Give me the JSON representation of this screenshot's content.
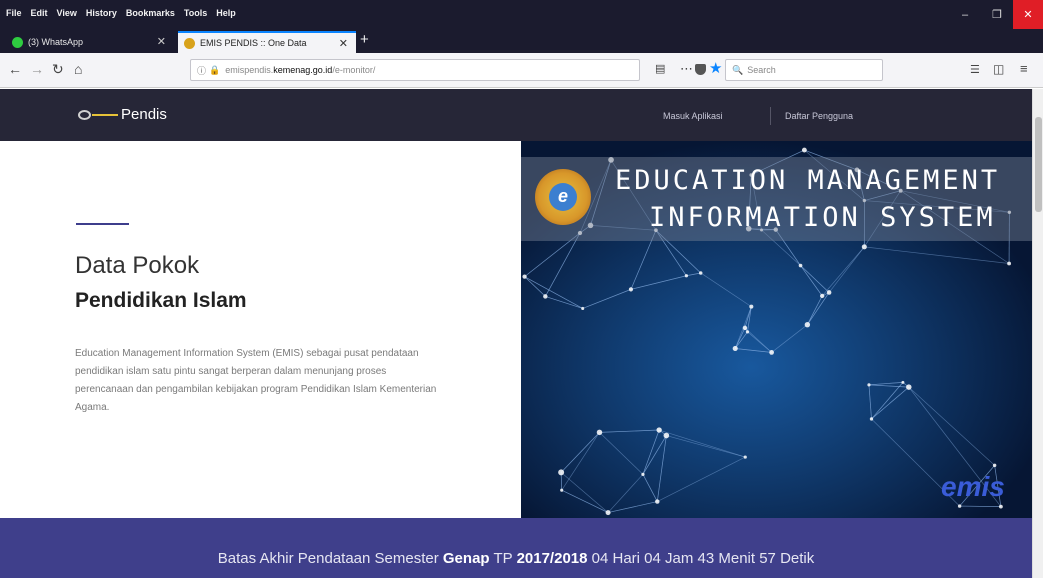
{
  "browser": {
    "menu": [
      "File",
      "Edit",
      "View",
      "History",
      "Bookmarks",
      "Tools",
      "Help"
    ],
    "window_controls": {
      "minimize": "–",
      "maximize": "❐",
      "close": "✕"
    },
    "tabs": [
      {
        "label": "(3) WhatsApp",
        "close": "✕"
      },
      {
        "label": "EMIS PENDIS :: One Data",
        "close": "✕"
      }
    ],
    "new_tab": "+",
    "url": {
      "prefix": "emispendis.",
      "host": "kemenag.go.id",
      "path": "/e-monitor/"
    },
    "search_placeholder": "Search"
  },
  "site": {
    "logo_text": "Pendis",
    "nav": [
      "Masuk Aplikasi",
      "Daftar Pengguna"
    ]
  },
  "hero": {
    "title_light": "Data Pokok",
    "title_bold": "Pendidikan Islam",
    "description": "Education Management Information System (EMIS) sebagai pusat pendataan pendidikan islam satu pintu sangat berperan dalam menunjang proses perencanaan dan pengambilan kebijakan program Pendidikan Islam Kementerian Agama."
  },
  "banner": {
    "line1": "EDUCATION MANAGEMENT",
    "line2": "INFORMATION SYSTEM",
    "logo_letter": "e",
    "watermark": "emis"
  },
  "countdown": {
    "prefix": "Batas Akhir Pendataan Semester",
    "semester": "Genap",
    "tp_label": "TP",
    "year": "2017/2018",
    "remaining": "04 Hari 04 Jam 43 Menit 57 Detik"
  },
  "colors": {
    "header_bg": "#262637",
    "footer_bg": "#3f3f8b",
    "accent_yellow": "#e6c238",
    "firefox_blue": "#0a84ff",
    "close_red": "#e01e26"
  },
  "icons": {
    "back": "back-arrow-icon",
    "forward": "forward-arrow-icon",
    "reload": "reload-icon",
    "home": "home-icon",
    "info": "info-icon",
    "lock": "lock-icon",
    "page_actions": "more-icon",
    "pocket": "pocket-icon",
    "bookmark": "star-icon",
    "search": "search-icon",
    "library": "library-icon",
    "sidebar": "sidebar-icon",
    "menu": "hamburger-menu-icon"
  }
}
